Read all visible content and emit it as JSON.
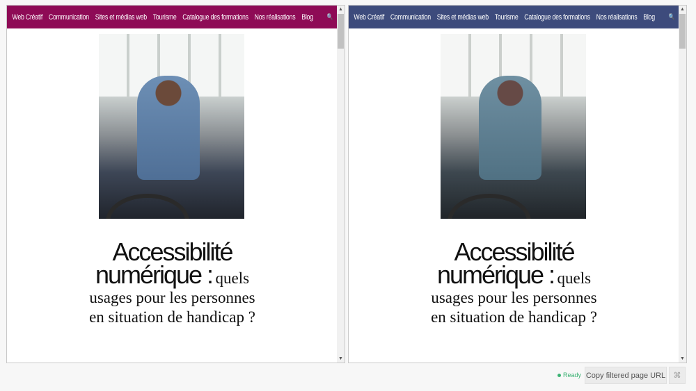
{
  "nav": {
    "items": [
      "Web Créatif",
      "Communication",
      "Sites et médias web",
      "Tourisme",
      "Catalogue des formations",
      "Nos réalisations",
      "Blog"
    ],
    "search_icon": "search-icon"
  },
  "panes": [
    {
      "nav_color": "#8e0b56"
    },
    {
      "nav_color": "#3d4b7c"
    }
  ],
  "article": {
    "title_big": "Accessibilité numérique :",
    "title_rest": "quels usages pour les personnes en situation de handicap ?"
  },
  "footer": {
    "status": "Ready",
    "status_color": "#3bb273",
    "copy_button": "Copy filtered page URL",
    "fullscreen_icon": "fullscreen-exit-icon"
  }
}
